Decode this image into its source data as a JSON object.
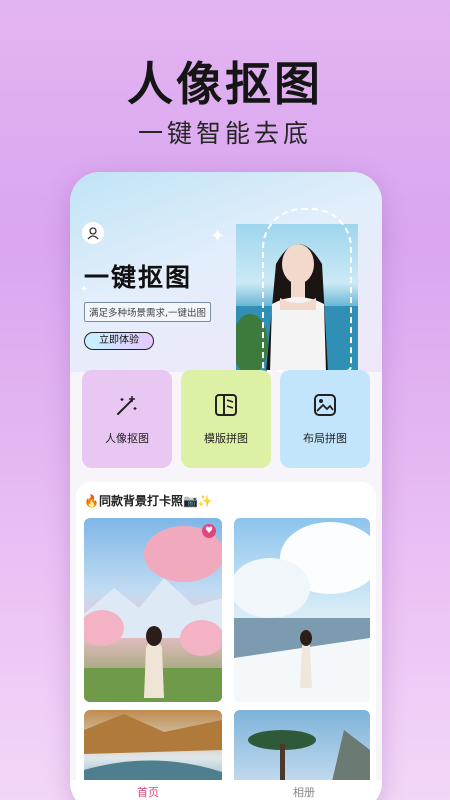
{
  "promo": {
    "title": "人像抠图",
    "subtitle": "一键智能去底"
  },
  "hero": {
    "title": "一键抠图",
    "description": "满足多种场景需求,一键出图",
    "cta": "立即体验"
  },
  "tools": [
    {
      "label": "人像抠图",
      "icon": "magic-wand-icon",
      "color": "#e8c7f2"
    },
    {
      "label": "模版拼图",
      "icon": "template-icon",
      "color": "#dcf1a6"
    },
    {
      "label": "布局拼图",
      "icon": "layout-icon",
      "color": "#c3e5fb"
    }
  ],
  "section": {
    "title": "🔥同款背景打卡照📷✨"
  },
  "tabs": [
    {
      "label": "首页",
      "active": true
    },
    {
      "label": "相册",
      "active": false
    }
  ],
  "colors": {
    "accent": "#e0457b",
    "background": "#dca9f0"
  }
}
